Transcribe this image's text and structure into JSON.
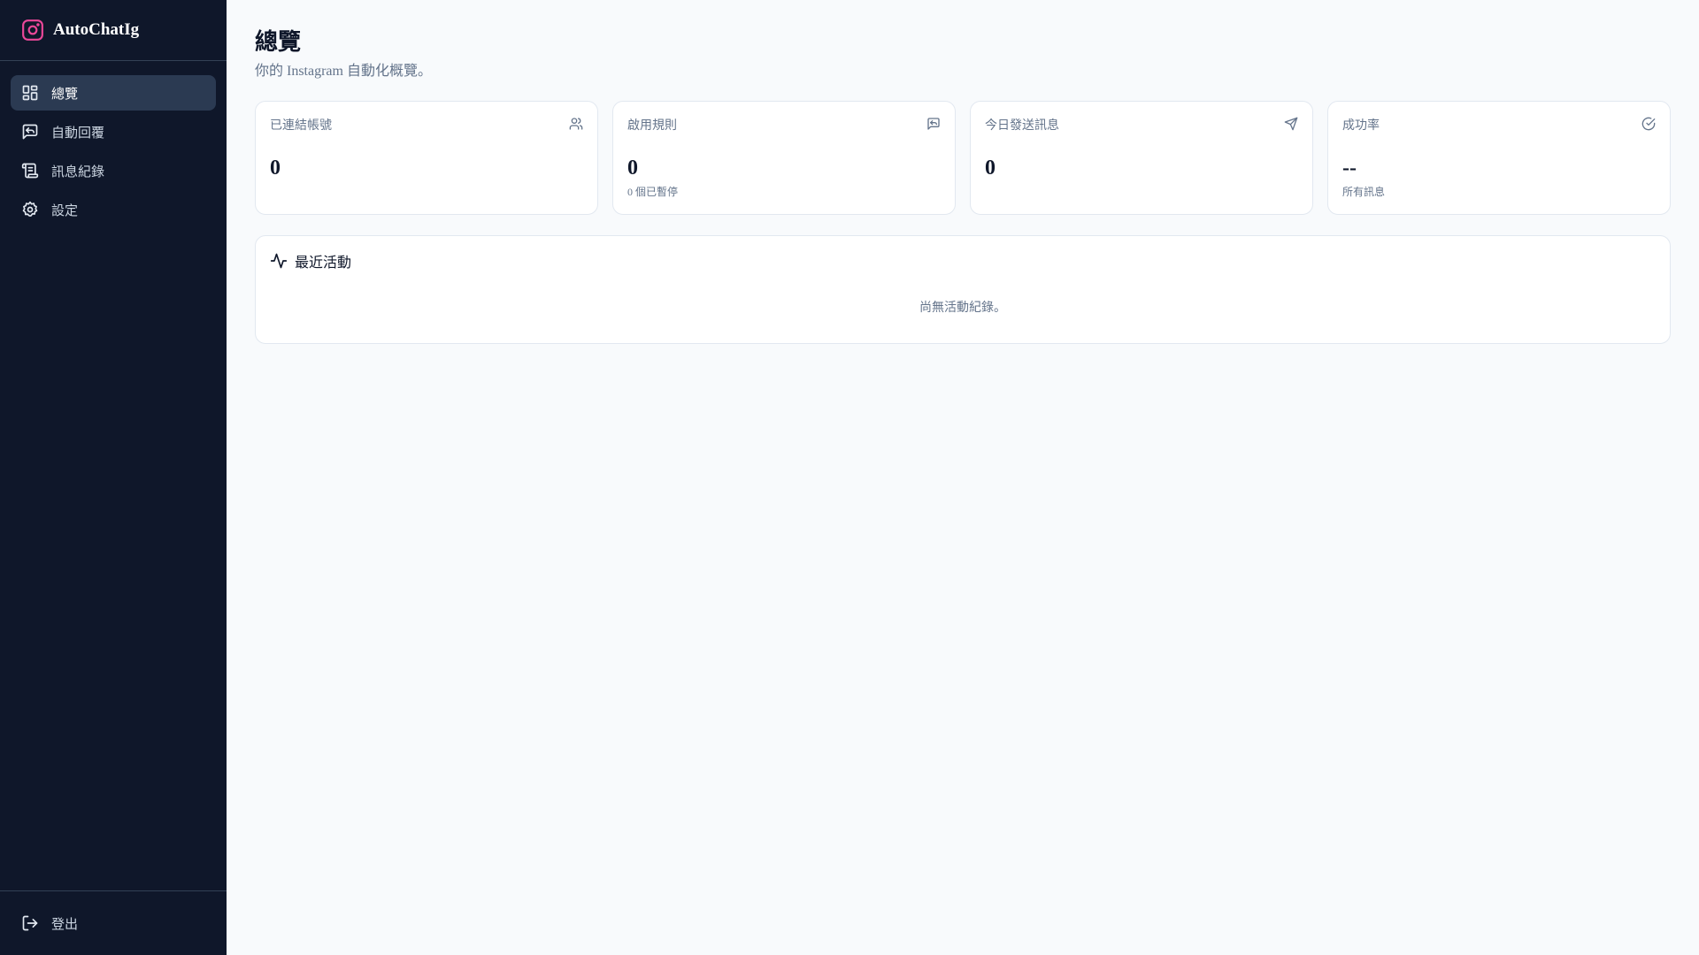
{
  "app": {
    "name": "AutoChatIg",
    "brand_color": "#ec4899"
  },
  "sidebar": {
    "items": [
      {
        "label": "總覽",
        "icon": "dashboard-icon",
        "active": true
      },
      {
        "label": "自動回覆",
        "icon": "message-reply-icon"
      },
      {
        "label": "訊息紀錄",
        "icon": "scroll-icon"
      },
      {
        "label": "設定",
        "icon": "gear-icon"
      }
    ],
    "logout": "登出"
  },
  "header": {
    "title": "總覽",
    "subtitle": "你的 Instagram 自動化概覽。"
  },
  "stats": [
    {
      "label": "已連結帳號",
      "value": "0",
      "sub": "",
      "icon": "users-icon"
    },
    {
      "label": "啟用規則",
      "value": "0",
      "sub": "0 個已暫停",
      "icon": "message-reply-icon"
    },
    {
      "label": "今日發送訊息",
      "value": "0",
      "sub": "",
      "icon": "send-icon"
    },
    {
      "label": "成功率",
      "value": "--",
      "sub": "所有訊息",
      "icon": "check-circle-icon"
    }
  ],
  "activity": {
    "title": "最近活動",
    "empty": "尚無活動紀錄。"
  }
}
